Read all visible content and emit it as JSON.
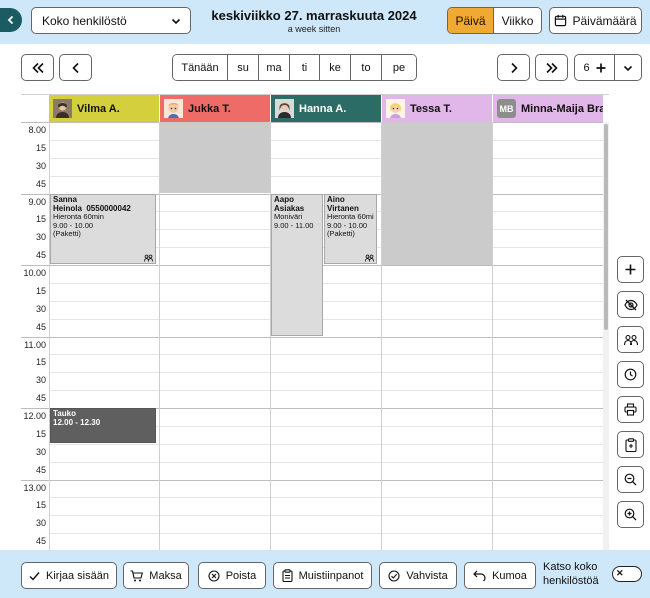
{
  "header": {
    "staff_select_value": "Koko henkilöstö",
    "date_title": "keskiviikko 27. marraskuuta 2024",
    "date_relative": "a week sitten",
    "view_day": "Päivä",
    "view_week": "Viikko",
    "date_button": "Päivämäärä"
  },
  "nav": {
    "today": "Tänään",
    "days": [
      "su",
      "ma",
      "ti",
      "ke",
      "to",
      "pe"
    ],
    "column_count": "6"
  },
  "staff": [
    {
      "name": "Vilma A.",
      "color": "#d4cf3d",
      "avatar": "photo-avatar-icon"
    },
    {
      "name": "Jukka T.",
      "color": "#ee6b68",
      "avatar": "cartoon-avatar-icon"
    },
    {
      "name": "Hanna A.",
      "color": "#2b6d66",
      "avatar": "photo-avatar-icon"
    },
    {
      "name": "Tessa T.",
      "color": "#e1b6e8",
      "avatar": "cartoon-avatar-icon"
    },
    {
      "name": "Minna-Maija Brax",
      "color": "#e1b6e8",
      "initials": "MB",
      "avatar": "initials-avatar"
    }
  ],
  "times": [
    "8.00",
    "15",
    "30",
    "45",
    "9.00",
    "15",
    "30",
    "45",
    "10.00",
    "15",
    "30",
    "45",
    "11.00",
    "15",
    "30",
    "45",
    "12.00",
    "15",
    "30",
    "45",
    "13.00",
    "15",
    "30",
    "45"
  ],
  "events": [
    {
      "name": "Sanna Heinola",
      "phone": "0550000042",
      "service": "Hieronta 60min",
      "time": "9.00 - 10.00",
      "note": "(Paketti)",
      "icon": "package-icon"
    },
    {
      "name": "Aapo Asiakas",
      "service": "Moniväri",
      "time": "9.00 - 11.00"
    },
    {
      "name": "Aino Virtanen",
      "service": "Hieronta 60mi",
      "time": "9.00 - 10.00",
      "note": "(Paketti)",
      "icon": "package-icon"
    },
    {
      "name": "Tauko",
      "time": "12.00 - 12.30"
    }
  ],
  "footer": {
    "checkin": "Kirjaa sisään",
    "pay": "Maksa",
    "delete": "Poista",
    "notes": "Muistiinpanot",
    "confirm": "Vahvista",
    "cancel": "Kumoa",
    "view_all_label": "Katso koko henkilöstöä"
  },
  "colors": {
    "header_bg": "#cfe8f9",
    "active_view": "#f0a932",
    "back_button": "#1b5c62",
    "unavailable": "#cbcbcb",
    "break": "#5f5f5f"
  }
}
